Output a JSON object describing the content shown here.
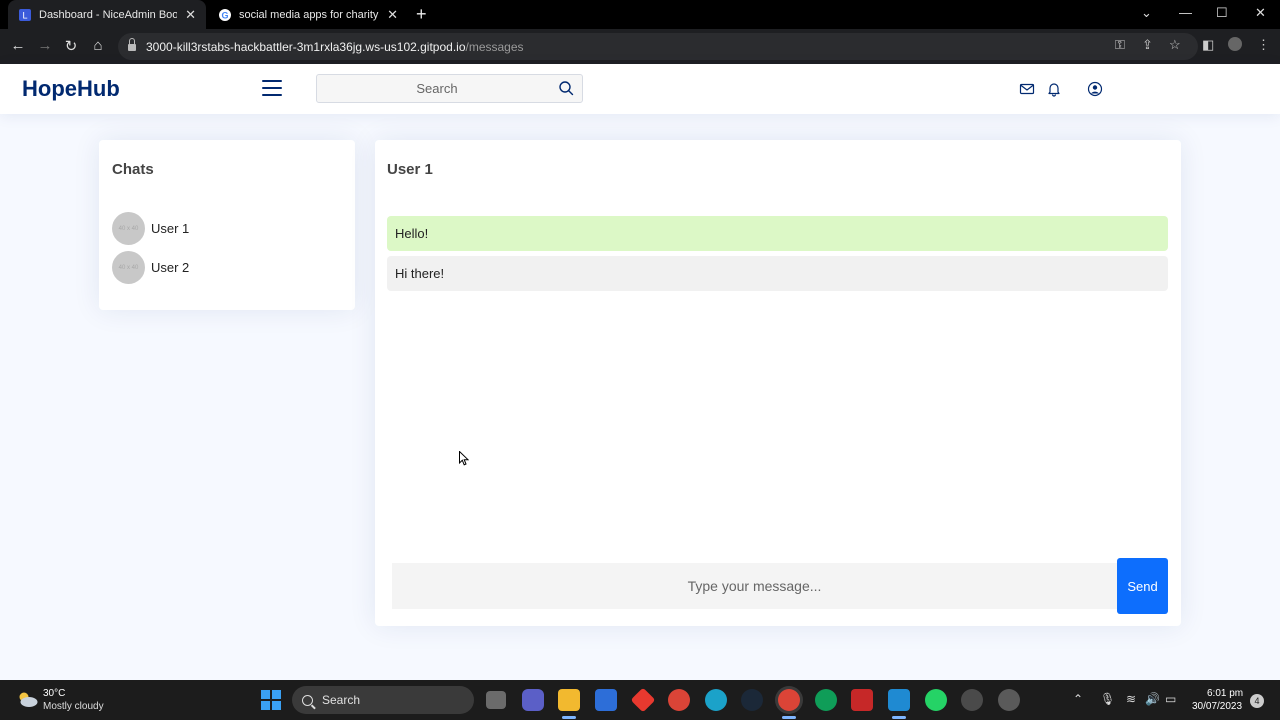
{
  "browser": {
    "tabs": [
      {
        "title": "Dashboard - NiceAdmin Bootstra",
        "active": true
      },
      {
        "title": "social media apps for charity - Go",
        "active": false
      }
    ],
    "url_host": "3000-kill3rstabs-hackbattler-3m1rxla36jg.ws-us102.gitpod.io",
    "url_path": "/messages"
  },
  "header": {
    "brand": "HopeHub",
    "search_placeholder": "Search"
  },
  "chats": {
    "title": "Chats",
    "avatar_text": "40 x 40",
    "items": [
      {
        "name": "User 1"
      },
      {
        "name": "User 2"
      }
    ]
  },
  "conversation": {
    "title": "User 1",
    "messages": [
      {
        "text": "Hello!",
        "type": "sent"
      },
      {
        "text": "Hi there!",
        "type": "received"
      }
    ],
    "input_placeholder": "Type your message...",
    "send_label": "Send"
  },
  "taskbar": {
    "weather_temp": "30°C",
    "weather_desc": "Mostly cloudy",
    "search_label": "Search",
    "time": "6:01 pm",
    "date": "30/07/2023",
    "notification_count": "4"
  },
  "colors": {
    "brand": "#012970",
    "sent_bubble": "#dcf8c6",
    "received_bubble": "#f1f1f1",
    "send_button": "#0d6efd"
  }
}
